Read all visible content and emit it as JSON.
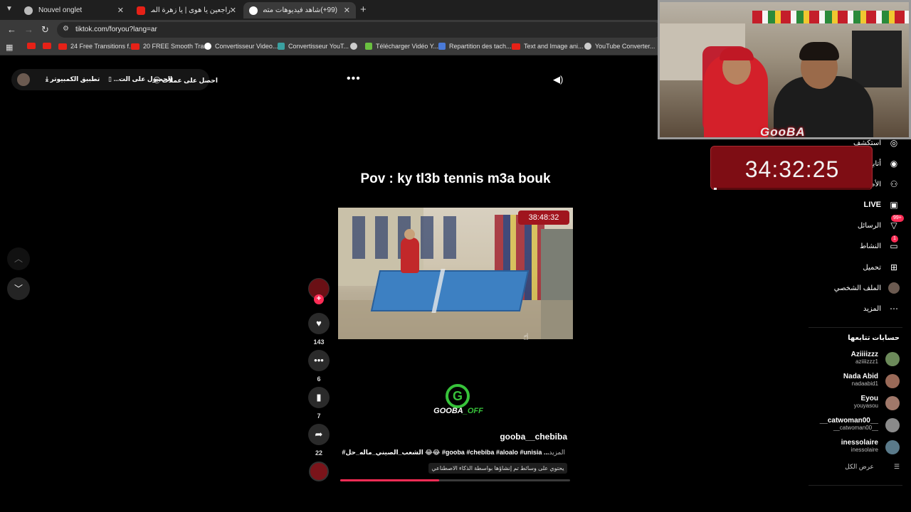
{
  "browser": {
    "tabs": [
      {
        "title": "Nouvel onglet",
        "icon": "chrome-icon"
      },
      {
        "title": "راجعين يا هوى | يا زهرة المساكين",
        "icon": "youtube-icon"
      },
      {
        "title": "(99+)شاهد فيديوهات متصدّ",
        "icon": "tiktok-icon"
      }
    ],
    "new_tab": "+",
    "url": "tiktok.com/foryou?lang=ar",
    "bookmarks": [
      {
        "label": "",
        "icon": "youtube-icon"
      },
      {
        "label": "",
        "icon": "youtube-icon"
      },
      {
        "label": "24 Free Transitions f...",
        "icon": "youtube-icon"
      },
      {
        "label": "20 FREE Smooth Tra...",
        "icon": "youtube-icon"
      },
      {
        "label": "Convertisseur Video...",
        "icon": "google-icon"
      },
      {
        "label": "Convertisseur YouT...",
        "icon": "converter-icon"
      },
      {
        "label": "",
        "icon": "globe-icon"
      },
      {
        "label": "Télécharger Vidéo Y...",
        "icon": "download-icon"
      },
      {
        "label": "Repartition des tach...",
        "icon": "docs-icon"
      },
      {
        "label": "Text and Image ani...",
        "icon": "youtube-icon"
      },
      {
        "label": "YouTube Converter...",
        "icon": "globe-icon"
      }
    ]
  },
  "topbar": {
    "get_coins": "احصل على عملات",
    "get_app": "الحصول على الت...",
    "desktop_app": "تطبيق الكمبيوتر"
  },
  "video": {
    "caption": "Pov : ky tl3b tennis m3a bouk",
    "overlay_timer": "38:48:32",
    "author": "gooba__chebiba",
    "description": "#الشعب_الصيني_ماله_حل 😂😂 #gooba #chebiba #aloalo #unisia ...",
    "more": "المزيد",
    "ai_label": "يحتوي على وسائط تم إنشاؤها بواسطة الذكاء الاصطناعي",
    "progress": 0.43,
    "logo_letter": "G",
    "logo_word_a": "GOOBA",
    "logo_word_b": "_OFF"
  },
  "actions": {
    "likes": "143",
    "comments": "6",
    "saves": "7",
    "shares": "22",
    "follow_plus": "+"
  },
  "sidebar": {
    "items": [
      {
        "label": "استكشف",
        "icon": "compass-icon"
      },
      {
        "label": "أتابع",
        "icon": "following-icon"
      },
      {
        "label": "الأصدقاء",
        "icon": "friends-icon"
      },
      {
        "label": "LIVE",
        "icon": "live-icon"
      },
      {
        "label": "الرسائل",
        "icon": "messages-icon",
        "badge": "99+"
      },
      {
        "label": "النشاط",
        "icon": "activity-icon",
        "badge": "1"
      },
      {
        "label": "تحميل",
        "icon": "upload-icon"
      },
      {
        "label": "الملف الشخصي",
        "icon": "profile-icon"
      },
      {
        "label": "المزيد",
        "icon": "more-icon"
      }
    ],
    "following_title": "حسابات تتابعها",
    "accounts": [
      {
        "name": "Aziiiizzz",
        "handle": "aziiiizzz1",
        "color": "#6c8a5a"
      },
      {
        "name": "Nada Abid",
        "handle": "nadaabid1",
        "color": "#9a6a58"
      },
      {
        "name": "Eyou",
        "handle": "youyasou",
        "color": "#a0786a"
      },
      {
        "name": "__catwoman00__",
        "handle": "__catwoman00__",
        "color": "#8a8a8a"
      },
      {
        "name": "inessolaire",
        "handle": "inessolaire",
        "color": "#5a7a8a"
      }
    ],
    "see_all": "عرض الكل"
  },
  "stream_overlay": {
    "logo": "GooBA",
    "clock": "34:32:25",
    "clock_progress": 0.02
  },
  "colors": {
    "accent": "#fe2c55",
    "overlay_red": "#7e0d14",
    "logo_green": "#37c23a"
  }
}
